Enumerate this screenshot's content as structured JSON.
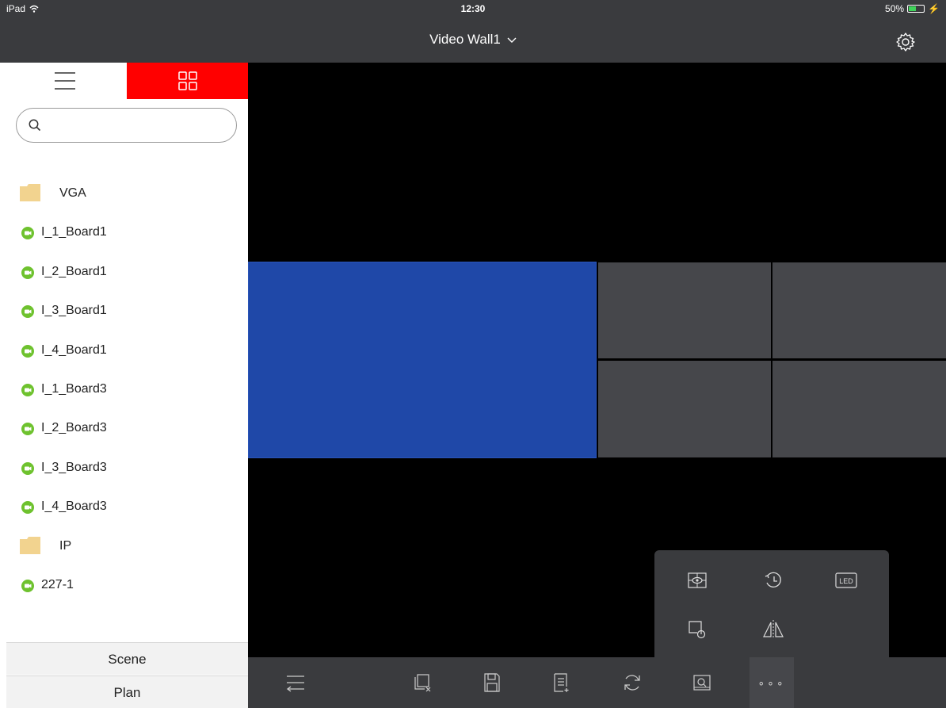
{
  "status_bar": {
    "carrier": "iPad",
    "time": "12:30",
    "battery": "50%",
    "battery_level": 0.5
  },
  "header": {
    "title": "Video Wall1",
    "chevron": "chevron-down-icon",
    "settings_icon": "gear-icon"
  },
  "sidebar": {
    "tabs": [
      {
        "icon": "list-icon",
        "active": false
      },
      {
        "icon": "grid-icon",
        "active": true
      }
    ],
    "search": {
      "placeholder": "",
      "value": ""
    },
    "tree": [
      {
        "type": "folder",
        "label": "VGA"
      },
      {
        "type": "camera",
        "label": "I_1_Board1"
      },
      {
        "type": "camera",
        "label": "I_2_Board1"
      },
      {
        "type": "camera",
        "label": "I_3_Board1"
      },
      {
        "type": "camera",
        "label": "I_4_Board1"
      },
      {
        "type": "camera",
        "label": "I_1_Board3"
      },
      {
        "type": "camera",
        "label": "I_2_Board3"
      },
      {
        "type": "camera",
        "label": "I_3_Board3"
      },
      {
        "type": "camera",
        "label": "I_4_Board3"
      },
      {
        "type": "folder",
        "label": "IP"
      },
      {
        "type": "camera",
        "label": "227-1"
      }
    ],
    "bottom_buttons": {
      "scene": "Scene",
      "plan": "Plan"
    }
  },
  "colors": {
    "accent_red": "#ff0000",
    "selected_pane": "#1f48a8",
    "pane": "#46474b",
    "bar": "#3a3b3e",
    "camera_online": "#6ec22e",
    "folder": "#f2d38f"
  },
  "popup_menu": [
    {
      "icon": "window-preview-icon"
    },
    {
      "icon": "playback-history-icon"
    },
    {
      "icon": "led-icon",
      "text": "LED"
    },
    {
      "icon": "screen-power-icon"
    },
    {
      "icon": "mirror-icon"
    }
  ],
  "toolbar": [
    {
      "icon": "collapse-sidebar-icon"
    },
    {
      "icon": "clear-windows-icon"
    },
    {
      "icon": "save-icon"
    },
    {
      "icon": "add-plan-icon"
    },
    {
      "icon": "refresh-icon"
    },
    {
      "icon": "zoom-window-icon"
    },
    {
      "icon": "more-icon",
      "active": true
    }
  ]
}
